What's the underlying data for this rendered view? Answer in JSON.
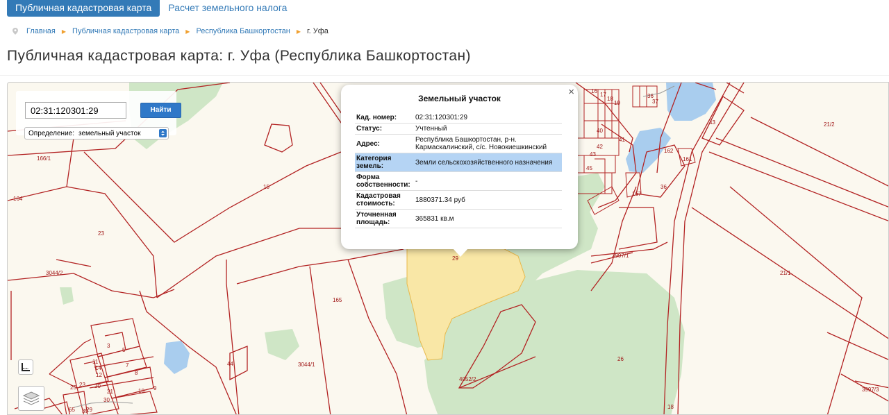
{
  "nav": {
    "tabs": [
      {
        "label": "Публичная кадастровая карта",
        "active": true
      },
      {
        "label": "Расчет земельного налога",
        "active": false
      }
    ]
  },
  "breadcrumb": {
    "items": [
      "Главная",
      "Публичная кадастровая карта",
      "Республика Башкортостан",
      "г. Уфа"
    ]
  },
  "page": {
    "title": "Публичная кадастровая карта: г. Уфа (Республика Башкортостан)"
  },
  "search": {
    "value": "02:31:120301:29",
    "button_label": "Найти",
    "definition_label": "Определение:",
    "definition_value": "земельный участок"
  },
  "popup": {
    "title": "Земельный участок",
    "close": "×",
    "rows": [
      {
        "key": "Кад. номер:",
        "value": "02:31:120301:29"
      },
      {
        "key": "Статус:",
        "value": "Учтенный"
      },
      {
        "key": "Адрес:",
        "value": "Республика Башкортостан, р-н. Кармаскалинский, с/с. Новокиешкинский"
      },
      {
        "key": "Категория земель:",
        "value": "Земли сельскохозяйственного назначения",
        "selected": true
      },
      {
        "key": "Форма собственности:",
        "value": "-"
      },
      {
        "key": "Кадастровая стоимость:",
        "value": "1880371.34 руб"
      },
      {
        "key": "Уточненная площадь:",
        "value": "365831 кв.м"
      }
    ]
  },
  "map": {
    "parcel_labels": [
      "166/1",
      "164",
      "23",
      "3044/2",
      "15",
      "165",
      "44",
      "3044/1",
      "29",
      "26",
      "4052/2",
      "3997/1",
      "21/1",
      "21/2",
      "36",
      "43",
      "161",
      "162",
      "167",
      "3997/3",
      "3",
      "5",
      "7",
      "8",
      "9",
      "10",
      "11",
      "12",
      "14",
      "20",
      "21",
      "23",
      "25",
      "29",
      "30",
      "36",
      "37",
      "39",
      "40",
      "41",
      "42",
      "43",
      "45",
      "16",
      "17",
      "18",
      "19",
      "65",
      "18"
    ],
    "colors": {
      "background": "#fbf8ef",
      "forest": "#cfe6c6",
      "water": "#a9cdee",
      "boundary": "#b22222",
      "selected_fill": "#f9e7a6",
      "selected_stroke": "#e8b84a"
    },
    "icons": [
      "ruler-icon",
      "layers-icon"
    ]
  }
}
